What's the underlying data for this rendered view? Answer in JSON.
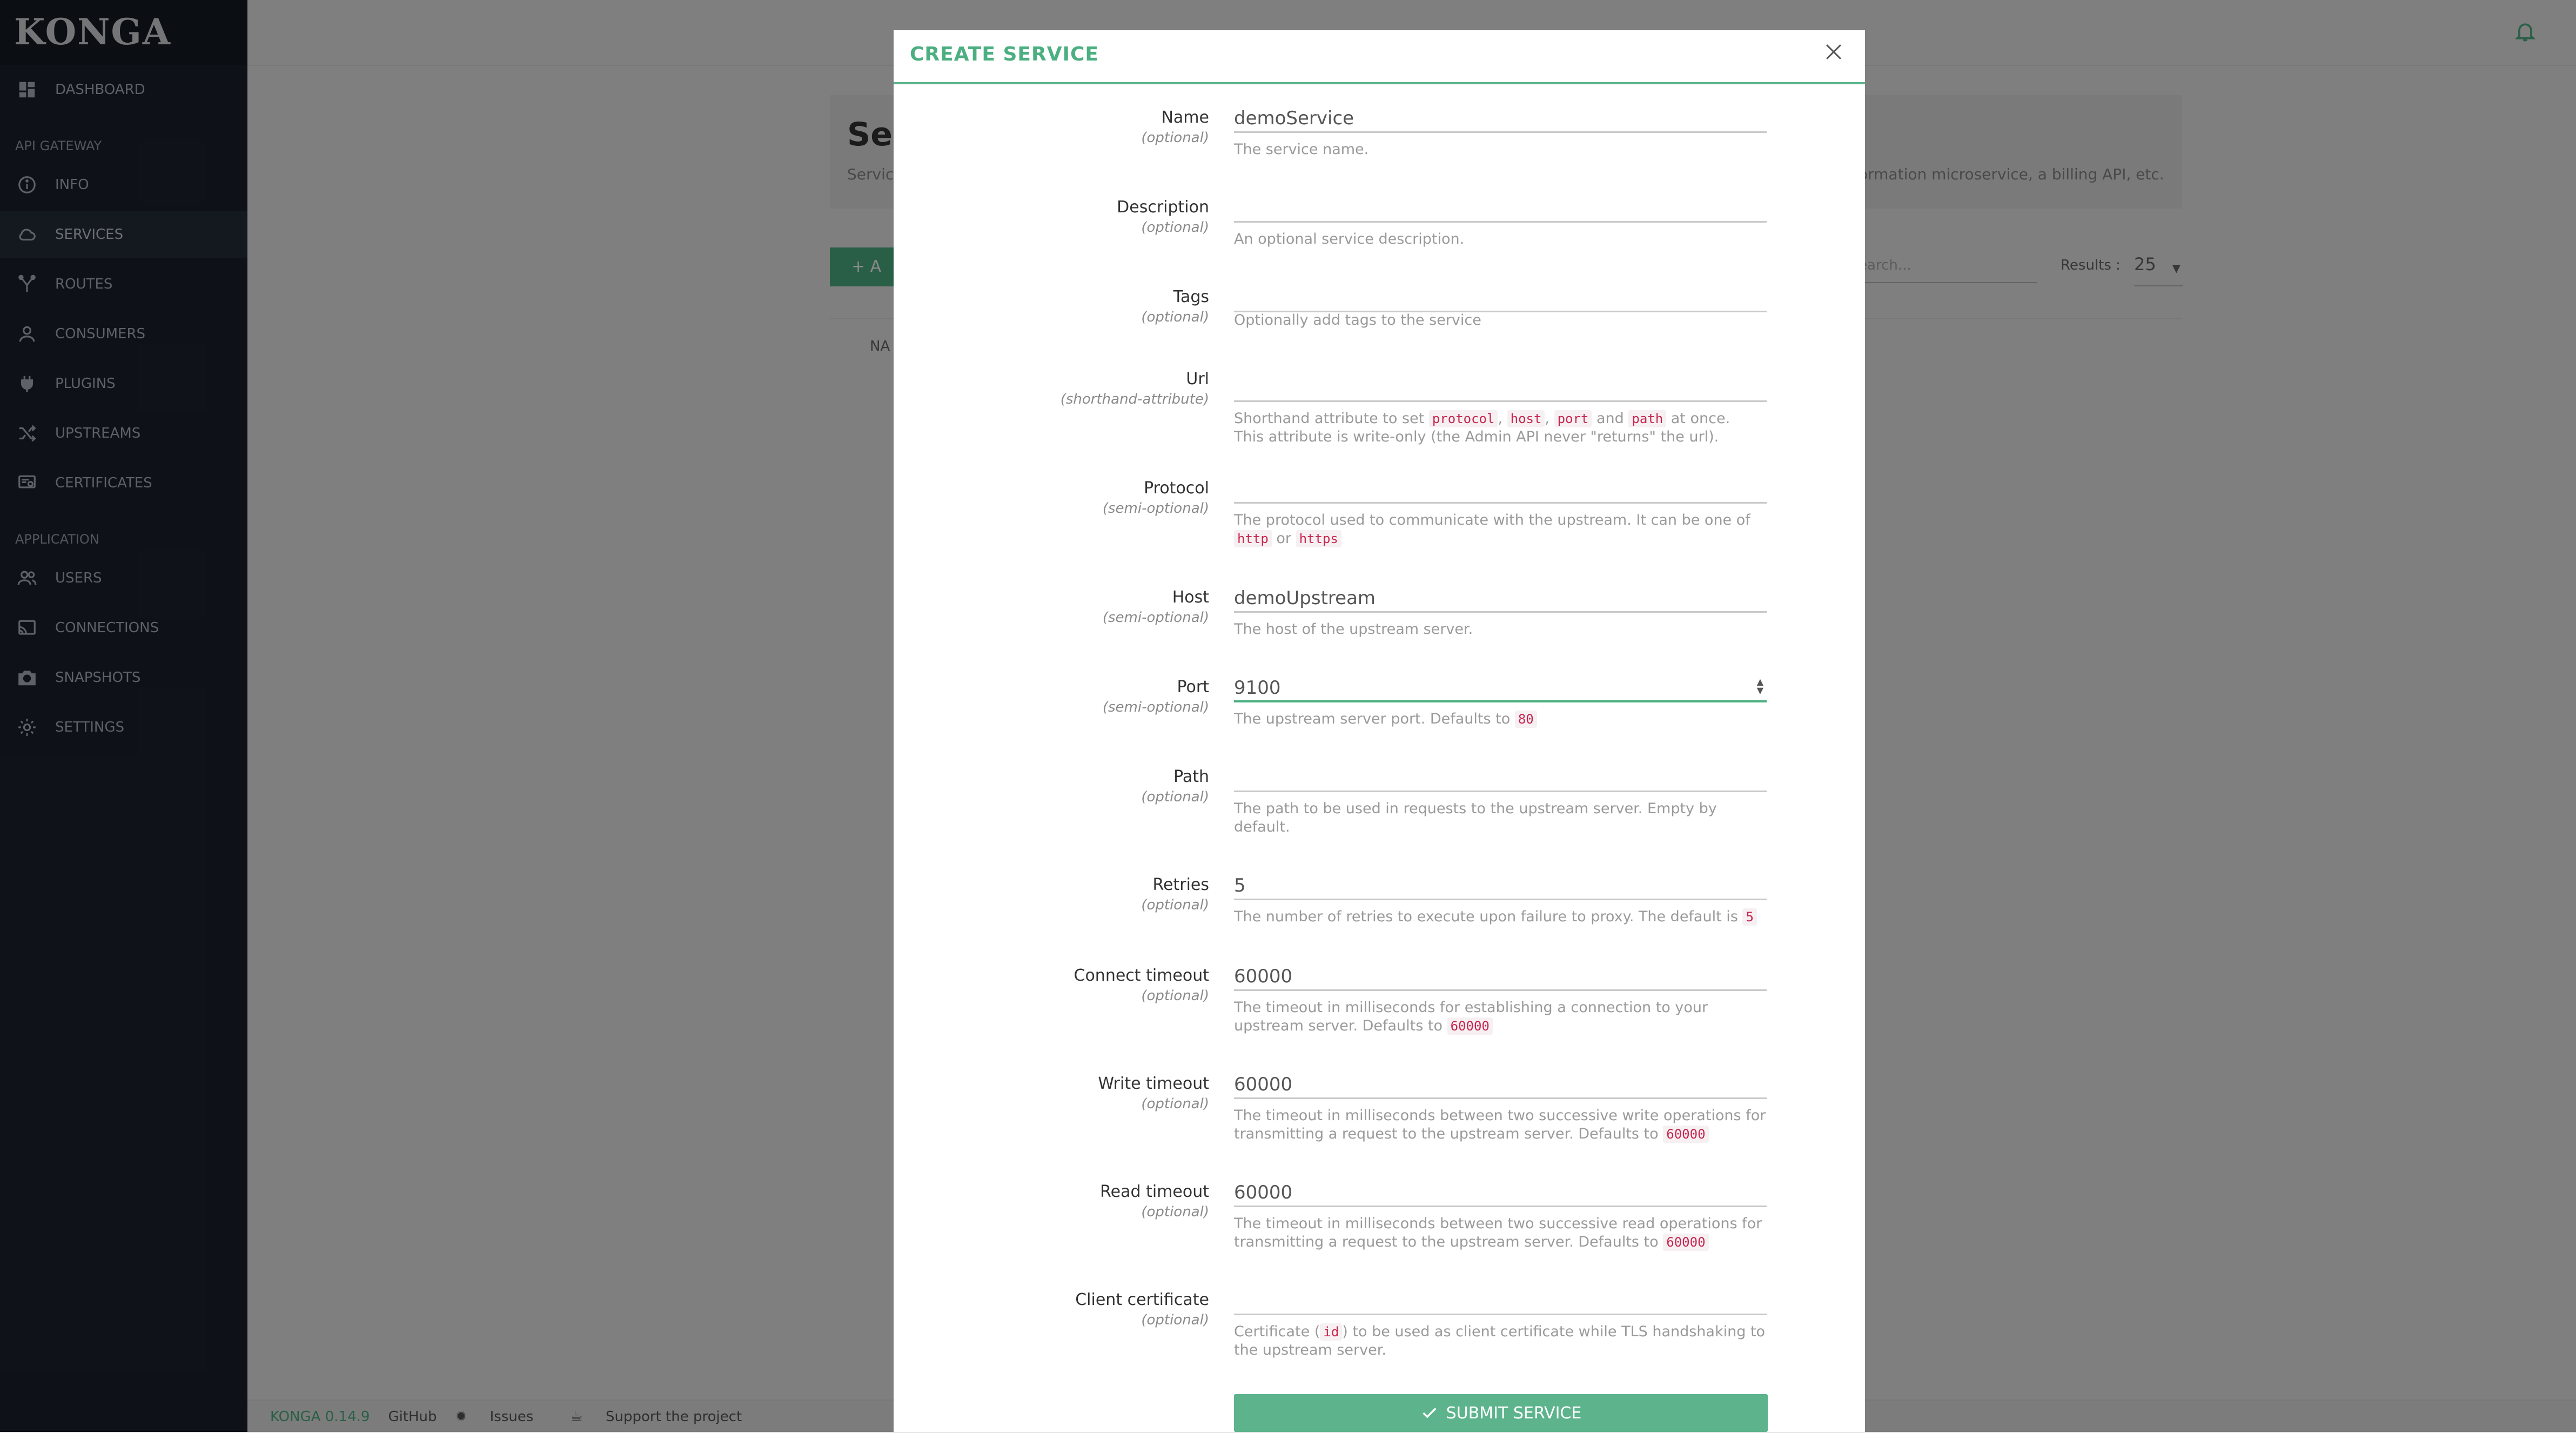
{
  "app": {
    "logo": "KONGA"
  },
  "sidebar": {
    "sections": [
      {
        "label": "API GATEWAY"
      },
      {
        "label": "APPLICATION"
      }
    ],
    "items": [
      {
        "label": "DASHBOARD",
        "icon": "dashboard-icon"
      },
      {
        "label": "INFO",
        "icon": "info-icon"
      },
      {
        "label": "SERVICES",
        "icon": "cloud-icon",
        "active": true
      },
      {
        "label": "ROUTES",
        "icon": "routes-icon"
      },
      {
        "label": "CONSUMERS",
        "icon": "user-icon"
      },
      {
        "label": "PLUGINS",
        "icon": "plug-icon"
      },
      {
        "label": "UPSTREAMS",
        "icon": "shuffle-icon"
      },
      {
        "label": "CERTIFICATES",
        "icon": "certificate-icon"
      },
      {
        "label": "USERS",
        "icon": "users-icon"
      },
      {
        "label": "CONNECTIONS",
        "icon": "cast-icon"
      },
      {
        "label": "SNAPSHOTS",
        "icon": "camera-icon"
      },
      {
        "label": "SETTINGS",
        "icon": "gear-icon"
      }
    ]
  },
  "background": {
    "panel_title": "Ser",
    "panel_desc": "Servic",
    "panel_desc_right": "ormation microservice, a billing API, etc.",
    "add_button": "+ A",
    "search_placeholder": "earch...",
    "results_label": "Results :",
    "results_value": "25",
    "table_header": "NA"
  },
  "footer": {
    "brand": "KONGA 0.14.9",
    "github": "GitHub",
    "issues": "Issues",
    "support": "Support the project"
  },
  "modal": {
    "title": "CREATE SERVICE",
    "fields": {
      "name": {
        "label": "Name",
        "sub": "(optional)",
        "value": "demoService",
        "help": "The service name."
      },
      "description": {
        "label": "Description",
        "sub": "(optional)",
        "value": "",
        "help": "An optional service description."
      },
      "tags": {
        "label": "Tags",
        "sub": "(optional)",
        "value": "",
        "help": "Optionally add tags to the service"
      },
      "url": {
        "label": "Url",
        "sub": "(shorthand-attribute)",
        "value": "",
        "help_1": "Shorthand attribute to set",
        "code_1": "protocol",
        "code_2": "host",
        "code_3": "port",
        "help_and": "and",
        "code_4": "path",
        "help_2": "at once.",
        "help_3": "This attribute is write-only (the Admin API never \"returns\" the url)."
      },
      "protocol": {
        "label": "Protocol",
        "sub": "(semi-optional)",
        "value": "",
        "help_1": "The protocol used to communicate with the upstream. It can be one of",
        "code_1": "http",
        "help_or": "or",
        "code_2": "https"
      },
      "host": {
        "label": "Host",
        "sub": "(semi-optional)",
        "value": "demoUpstream",
        "help": "The host of the upstream server."
      },
      "port": {
        "label": "Port",
        "sub": "(semi-optional)",
        "value": "9100",
        "help": "The upstream server port. Defaults to",
        "code": "80"
      },
      "path": {
        "label": "Path",
        "sub": "(optional)",
        "value": "",
        "help": "The path to be used in requests to the upstream server. Empty by default."
      },
      "retries": {
        "label": "Retries",
        "sub": "(optional)",
        "value": "5",
        "help": "The number of retries to execute upon failure to proxy. The default is",
        "code": "5"
      },
      "connect_timeout": {
        "label": "Connect timeout",
        "sub": "(optional)",
        "value": "60000",
        "help": "The timeout in milliseconds for establishing a connection to your upstream server. Defaults to",
        "code": "60000"
      },
      "write_timeout": {
        "label": "Write timeout",
        "sub": "(optional)",
        "value": "60000",
        "help": "The timeout in milliseconds between two successive write operations for transmitting a request to the upstream server. Defaults to",
        "code": "60000"
      },
      "read_timeout": {
        "label": "Read timeout",
        "sub": "(optional)",
        "value": "60000",
        "help": "The timeout in milliseconds between two successive read operations for transmitting a request to the upstream server. Defaults to",
        "code": "60000"
      },
      "client_certificate": {
        "label": "Client certificate",
        "sub": "(optional)",
        "value": "",
        "help_1": "Certificate (",
        "code": "id",
        "help_2": ") to be used as client certificate while TLS handshaking to the upstream server."
      }
    },
    "submit_label": "SUBMIT SERVICE"
  },
  "colors": {
    "accent": "#4caf81",
    "sidebar": "#1b222d",
    "code": "#c7254e"
  }
}
